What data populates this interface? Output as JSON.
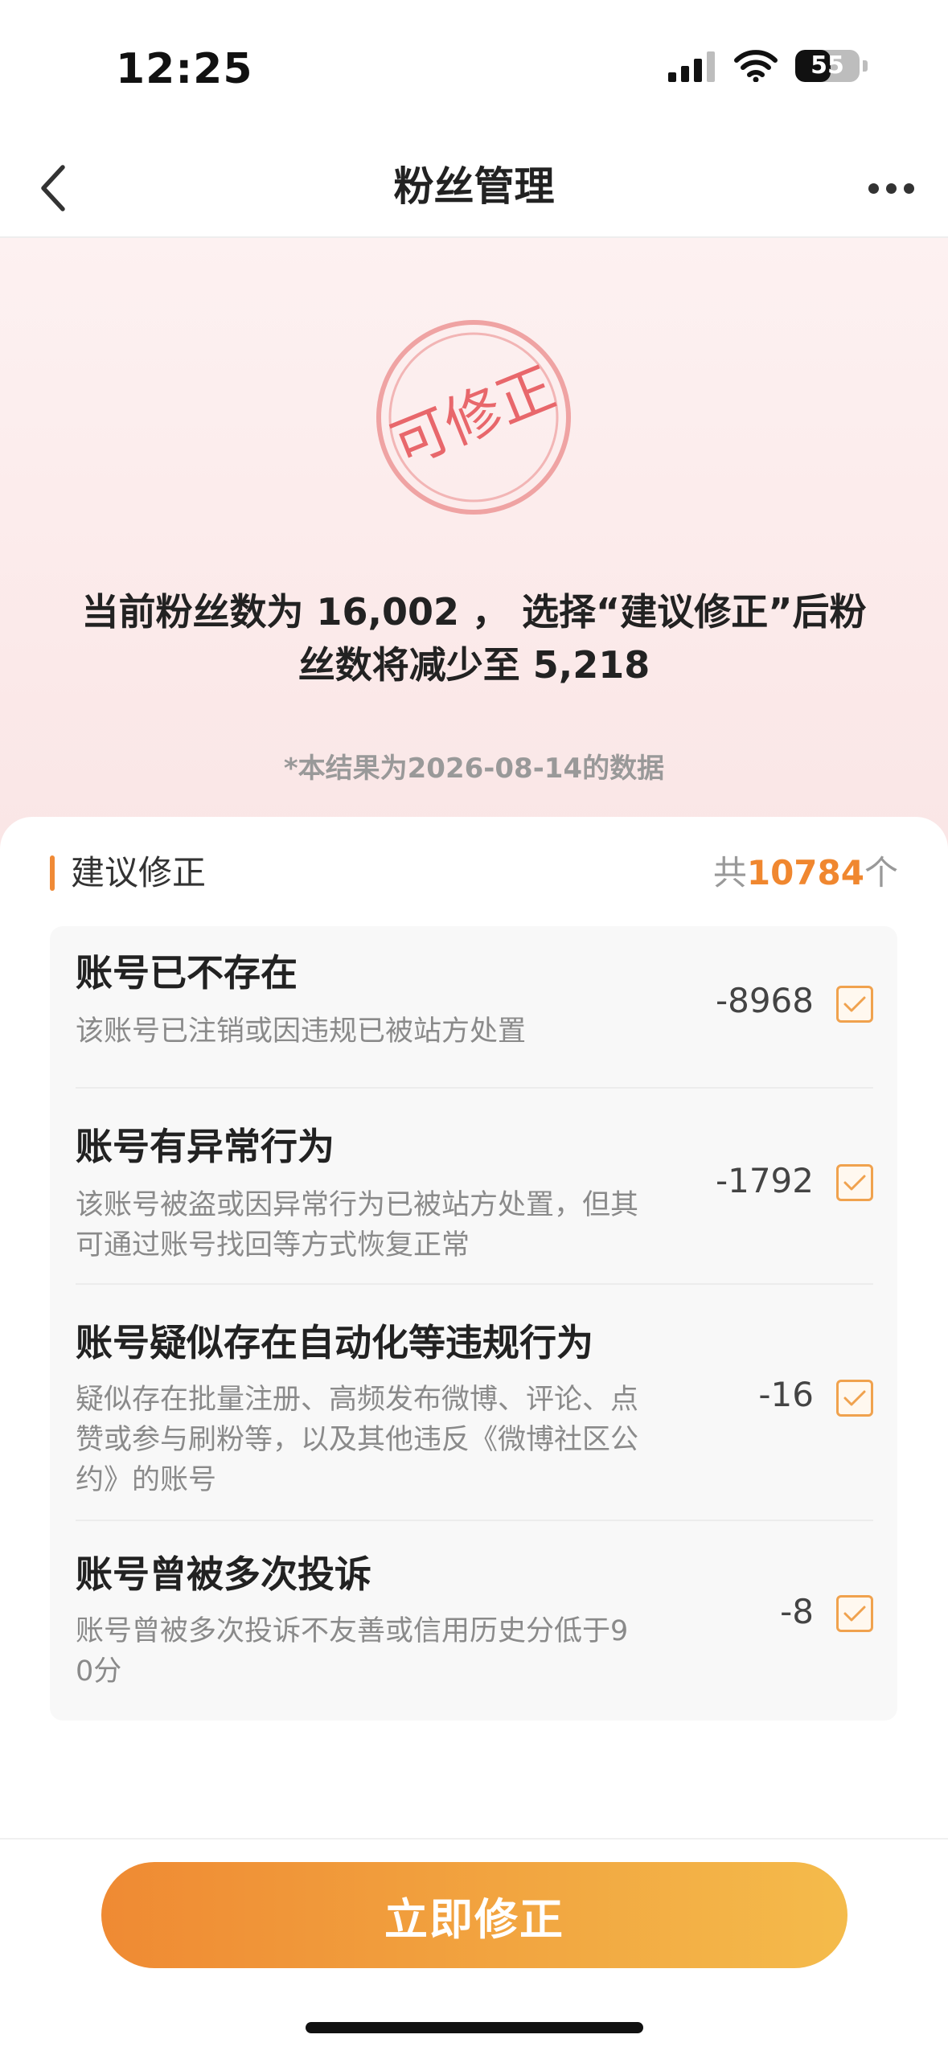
{
  "status_bar": {
    "time": "12:25",
    "battery": "55"
  },
  "nav": {
    "title": "粉丝管理"
  },
  "hero": {
    "stamp_text": "可修正",
    "summary_line1": "当前粉丝数为 16,002 ， 选择“建议修正”后粉",
    "summary_line2": "丝数将减少至 5,218",
    "data_note": "*本结果为2026-08-14的数据"
  },
  "section": {
    "title": "建议修正",
    "total_prefix": "共",
    "total_value": "10784",
    "total_suffix": "个"
  },
  "items": [
    {
      "title": "账号已不存在",
      "desc_lines": [
        "该账号已注销或因违规已被站方处置"
      ],
      "count": "-8968",
      "checked": true
    },
    {
      "title": "账号有异常行为",
      "desc_lines": [
        "该账号被盗或因异常行为已被站方处置，但其",
        "可通过账号找回等方式恢复正常"
      ],
      "count": "-1792",
      "checked": true
    },
    {
      "title": "账号疑似存在自动化等违规行为",
      "desc_lines": [
        "疑似存在批量注册、高频发布微博、评论、点",
        "赞或参与刷粉等，以及其他违反《微博社区公",
        "约》的账号"
      ],
      "count": "-16",
      "checked": true
    },
    {
      "title": "账号曾被多次投诉",
      "desc_lines": [
        "账号曾被多次投诉不友善或信用历史分低于9",
        "0分"
      ],
      "count": "-8",
      "checked": true
    }
  ],
  "primary_button": {
    "label": "立即修正"
  },
  "colors": {
    "accent": "#f0872f",
    "button_start": "#ef8a33",
    "button_end": "#f4bb4b",
    "stamp": "#e8676b"
  },
  "icons": {
    "back": "chevron-left-icon",
    "more": "ellipsis-icon",
    "check": "check-icon"
  }
}
